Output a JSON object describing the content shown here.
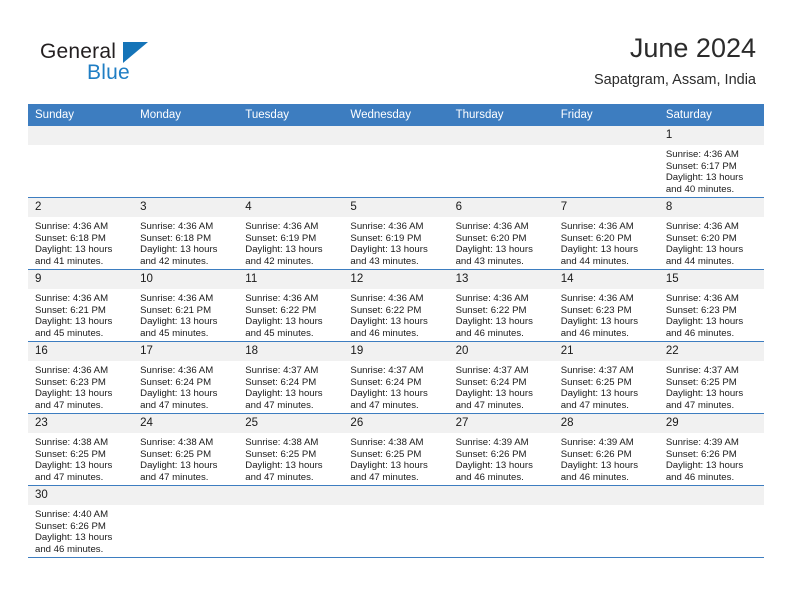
{
  "brand": {
    "name_line1": "General",
    "name_line2": "Blue",
    "accent_color": "#1f7ec4",
    "triangle_color": "#1574b8"
  },
  "header": {
    "title": "June 2024",
    "subtitle": "Sapatgram, Assam, India"
  },
  "theme": {
    "header_bar_color": "#3d7dc0",
    "daynum_band_color": "#f1f1f1",
    "row_divider_color": "#3d7dc0"
  },
  "weekday_headers": [
    "Sunday",
    "Monday",
    "Tuesday",
    "Wednesday",
    "Thursday",
    "Friday",
    "Saturday"
  ],
  "labels": {
    "sunrise_prefix": "Sunrise: ",
    "sunset_prefix": "Sunset: ",
    "daylight_prefix": "Daylight: "
  },
  "weeks": [
    [
      {
        "day": "",
        "sunrise": "",
        "sunset": "",
        "daylight_line1": "",
        "daylight_line2": ""
      },
      {
        "day": "",
        "sunrise": "",
        "sunset": "",
        "daylight_line1": "",
        "daylight_line2": ""
      },
      {
        "day": "",
        "sunrise": "",
        "sunset": "",
        "daylight_line1": "",
        "daylight_line2": ""
      },
      {
        "day": "",
        "sunrise": "",
        "sunset": "",
        "daylight_line1": "",
        "daylight_line2": ""
      },
      {
        "day": "",
        "sunrise": "",
        "sunset": "",
        "daylight_line1": "",
        "daylight_line2": ""
      },
      {
        "day": "",
        "sunrise": "",
        "sunset": "",
        "daylight_line1": "",
        "daylight_line2": ""
      },
      {
        "day": "1",
        "sunrise": "Sunrise: 4:36 AM",
        "sunset": "Sunset: 6:17 PM",
        "daylight_line1": "Daylight: 13 hours",
        "daylight_line2": "and 40 minutes."
      }
    ],
    [
      {
        "day": "2",
        "sunrise": "Sunrise: 4:36 AM",
        "sunset": "Sunset: 6:18 PM",
        "daylight_line1": "Daylight: 13 hours",
        "daylight_line2": "and 41 minutes."
      },
      {
        "day": "3",
        "sunrise": "Sunrise: 4:36 AM",
        "sunset": "Sunset: 6:18 PM",
        "daylight_line1": "Daylight: 13 hours",
        "daylight_line2": "and 42 minutes."
      },
      {
        "day": "4",
        "sunrise": "Sunrise: 4:36 AM",
        "sunset": "Sunset: 6:19 PM",
        "daylight_line1": "Daylight: 13 hours",
        "daylight_line2": "and 42 minutes."
      },
      {
        "day": "5",
        "sunrise": "Sunrise: 4:36 AM",
        "sunset": "Sunset: 6:19 PM",
        "daylight_line1": "Daylight: 13 hours",
        "daylight_line2": "and 43 minutes."
      },
      {
        "day": "6",
        "sunrise": "Sunrise: 4:36 AM",
        "sunset": "Sunset: 6:20 PM",
        "daylight_line1": "Daylight: 13 hours",
        "daylight_line2": "and 43 minutes."
      },
      {
        "day": "7",
        "sunrise": "Sunrise: 4:36 AM",
        "sunset": "Sunset: 6:20 PM",
        "daylight_line1": "Daylight: 13 hours",
        "daylight_line2": "and 44 minutes."
      },
      {
        "day": "8",
        "sunrise": "Sunrise: 4:36 AM",
        "sunset": "Sunset: 6:20 PM",
        "daylight_line1": "Daylight: 13 hours",
        "daylight_line2": "and 44 minutes."
      }
    ],
    [
      {
        "day": "9",
        "sunrise": "Sunrise: 4:36 AM",
        "sunset": "Sunset: 6:21 PM",
        "daylight_line1": "Daylight: 13 hours",
        "daylight_line2": "and 45 minutes."
      },
      {
        "day": "10",
        "sunrise": "Sunrise: 4:36 AM",
        "sunset": "Sunset: 6:21 PM",
        "daylight_line1": "Daylight: 13 hours",
        "daylight_line2": "and 45 minutes."
      },
      {
        "day": "11",
        "sunrise": "Sunrise: 4:36 AM",
        "sunset": "Sunset: 6:22 PM",
        "daylight_line1": "Daylight: 13 hours",
        "daylight_line2": "and 45 minutes."
      },
      {
        "day": "12",
        "sunrise": "Sunrise: 4:36 AM",
        "sunset": "Sunset: 6:22 PM",
        "daylight_line1": "Daylight: 13 hours",
        "daylight_line2": "and 46 minutes."
      },
      {
        "day": "13",
        "sunrise": "Sunrise: 4:36 AM",
        "sunset": "Sunset: 6:22 PM",
        "daylight_line1": "Daylight: 13 hours",
        "daylight_line2": "and 46 minutes."
      },
      {
        "day": "14",
        "sunrise": "Sunrise: 4:36 AM",
        "sunset": "Sunset: 6:23 PM",
        "daylight_line1": "Daylight: 13 hours",
        "daylight_line2": "and 46 minutes."
      },
      {
        "day": "15",
        "sunrise": "Sunrise: 4:36 AM",
        "sunset": "Sunset: 6:23 PM",
        "daylight_line1": "Daylight: 13 hours",
        "daylight_line2": "and 46 minutes."
      }
    ],
    [
      {
        "day": "16",
        "sunrise": "Sunrise: 4:36 AM",
        "sunset": "Sunset: 6:23 PM",
        "daylight_line1": "Daylight: 13 hours",
        "daylight_line2": "and 47 minutes."
      },
      {
        "day": "17",
        "sunrise": "Sunrise: 4:36 AM",
        "sunset": "Sunset: 6:24 PM",
        "daylight_line1": "Daylight: 13 hours",
        "daylight_line2": "and 47 minutes."
      },
      {
        "day": "18",
        "sunrise": "Sunrise: 4:37 AM",
        "sunset": "Sunset: 6:24 PM",
        "daylight_line1": "Daylight: 13 hours",
        "daylight_line2": "and 47 minutes."
      },
      {
        "day": "19",
        "sunrise": "Sunrise: 4:37 AM",
        "sunset": "Sunset: 6:24 PM",
        "daylight_line1": "Daylight: 13 hours",
        "daylight_line2": "and 47 minutes."
      },
      {
        "day": "20",
        "sunrise": "Sunrise: 4:37 AM",
        "sunset": "Sunset: 6:24 PM",
        "daylight_line1": "Daylight: 13 hours",
        "daylight_line2": "and 47 minutes."
      },
      {
        "day": "21",
        "sunrise": "Sunrise: 4:37 AM",
        "sunset": "Sunset: 6:25 PM",
        "daylight_line1": "Daylight: 13 hours",
        "daylight_line2": "and 47 minutes."
      },
      {
        "day": "22",
        "sunrise": "Sunrise: 4:37 AM",
        "sunset": "Sunset: 6:25 PM",
        "daylight_line1": "Daylight: 13 hours",
        "daylight_line2": "and 47 minutes."
      }
    ],
    [
      {
        "day": "23",
        "sunrise": "Sunrise: 4:38 AM",
        "sunset": "Sunset: 6:25 PM",
        "daylight_line1": "Daylight: 13 hours",
        "daylight_line2": "and 47 minutes."
      },
      {
        "day": "24",
        "sunrise": "Sunrise: 4:38 AM",
        "sunset": "Sunset: 6:25 PM",
        "daylight_line1": "Daylight: 13 hours",
        "daylight_line2": "and 47 minutes."
      },
      {
        "day": "25",
        "sunrise": "Sunrise: 4:38 AM",
        "sunset": "Sunset: 6:25 PM",
        "daylight_line1": "Daylight: 13 hours",
        "daylight_line2": "and 47 minutes."
      },
      {
        "day": "26",
        "sunrise": "Sunrise: 4:38 AM",
        "sunset": "Sunset: 6:25 PM",
        "daylight_line1": "Daylight: 13 hours",
        "daylight_line2": "and 47 minutes."
      },
      {
        "day": "27",
        "sunrise": "Sunrise: 4:39 AM",
        "sunset": "Sunset: 6:26 PM",
        "daylight_line1": "Daylight: 13 hours",
        "daylight_line2": "and 46 minutes."
      },
      {
        "day": "28",
        "sunrise": "Sunrise: 4:39 AM",
        "sunset": "Sunset: 6:26 PM",
        "daylight_line1": "Daylight: 13 hours",
        "daylight_line2": "and 46 minutes."
      },
      {
        "day": "29",
        "sunrise": "Sunrise: 4:39 AM",
        "sunset": "Sunset: 6:26 PM",
        "daylight_line1": "Daylight: 13 hours",
        "daylight_line2": "and 46 minutes."
      }
    ],
    [
      {
        "day": "30",
        "sunrise": "Sunrise: 4:40 AM",
        "sunset": "Sunset: 6:26 PM",
        "daylight_line1": "Daylight: 13 hours",
        "daylight_line2": "and 46 minutes."
      },
      {
        "day": "",
        "sunrise": "",
        "sunset": "",
        "daylight_line1": "",
        "daylight_line2": ""
      },
      {
        "day": "",
        "sunrise": "",
        "sunset": "",
        "daylight_line1": "",
        "daylight_line2": ""
      },
      {
        "day": "",
        "sunrise": "",
        "sunset": "",
        "daylight_line1": "",
        "daylight_line2": ""
      },
      {
        "day": "",
        "sunrise": "",
        "sunset": "",
        "daylight_line1": "",
        "daylight_line2": ""
      },
      {
        "day": "",
        "sunrise": "",
        "sunset": "",
        "daylight_line1": "",
        "daylight_line2": ""
      },
      {
        "day": "",
        "sunrise": "",
        "sunset": "",
        "daylight_line1": "",
        "daylight_line2": ""
      }
    ]
  ]
}
